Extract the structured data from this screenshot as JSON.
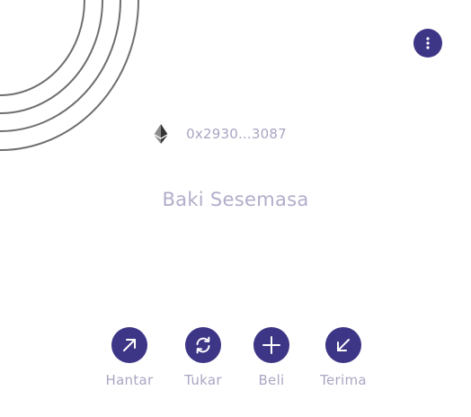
{
  "wallet": {
    "address": "0x2930...3087",
    "network_icon": "ethereum-icon"
  },
  "balance": {
    "label": "Baki Sesemasa"
  },
  "menu": {
    "icon": "more-vertical-icon"
  },
  "actions": [
    {
      "label": "Hantar",
      "icon": "arrow-up-right-icon"
    },
    {
      "label": "Tukar",
      "icon": "swap-icon"
    },
    {
      "label": "Beli",
      "icon": "plus-icon"
    },
    {
      "label": "Terima",
      "icon": "arrow-down-left-icon"
    }
  ],
  "colors": {
    "accent": "#3d3586",
    "muted_text": "#aaa6c3",
    "arc_stroke": "#6f6f6f"
  }
}
